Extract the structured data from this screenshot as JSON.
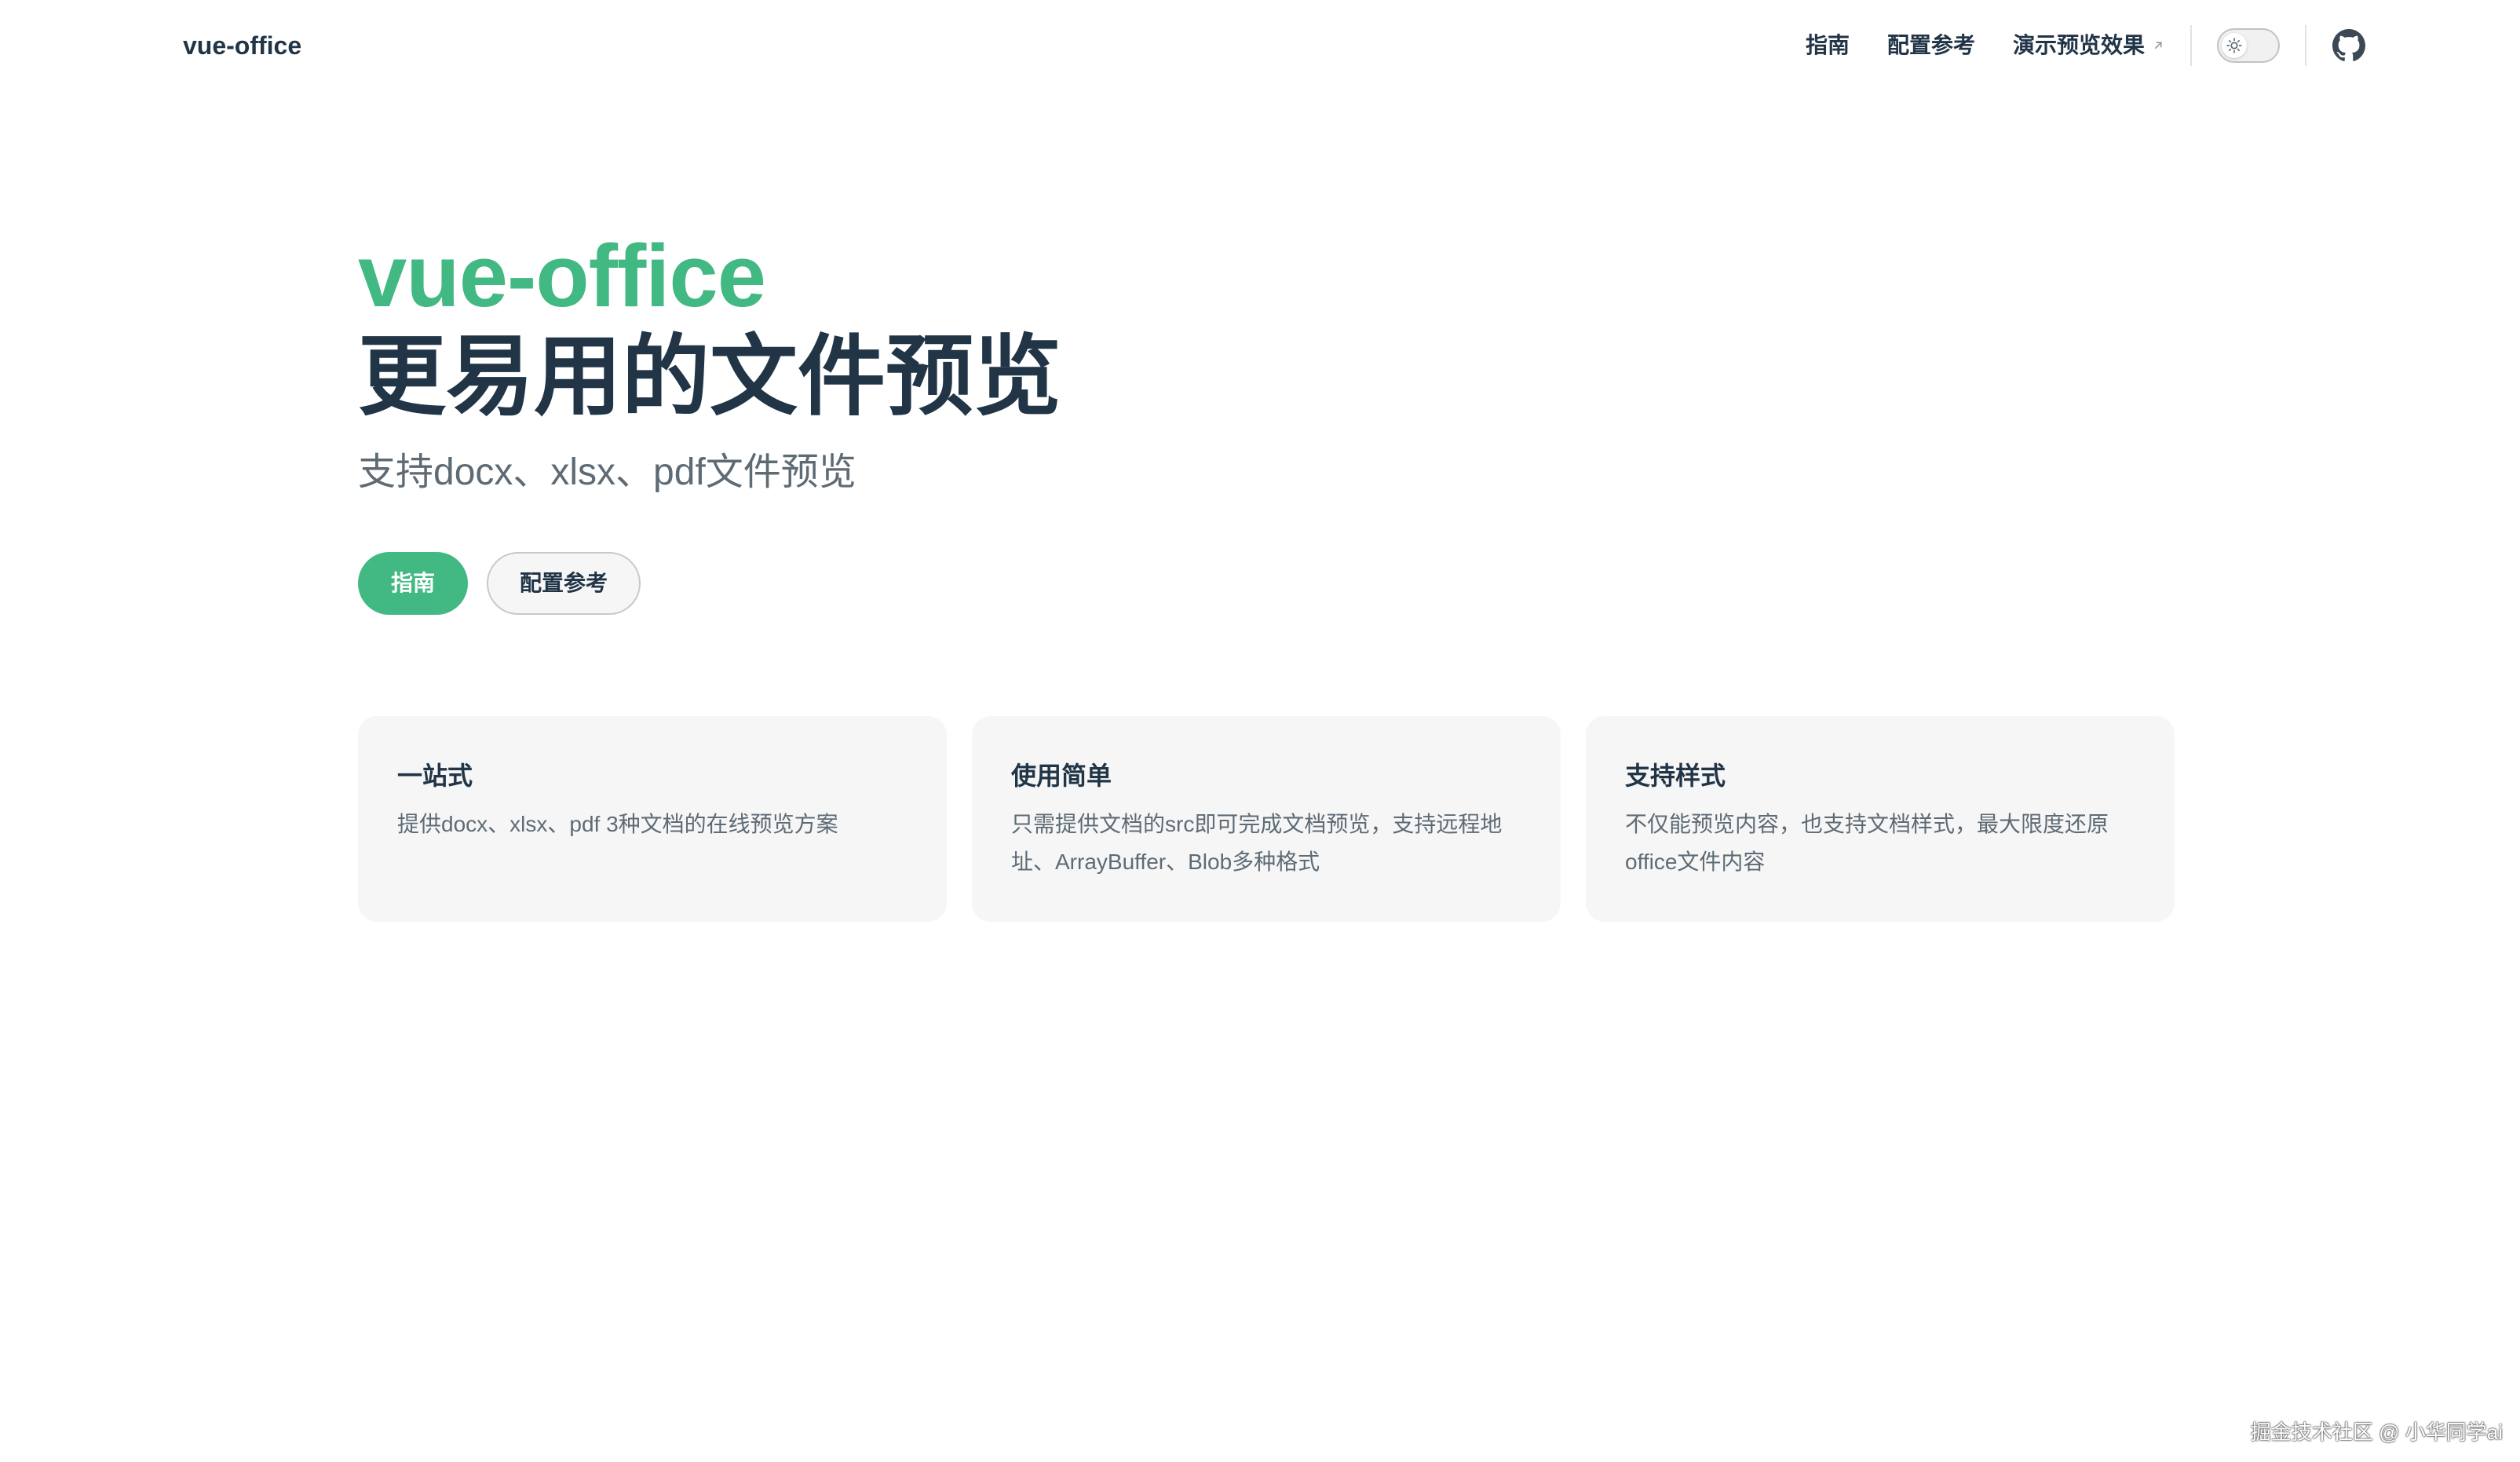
{
  "nav": {
    "brand": "vue-office",
    "links": [
      {
        "label": "指南"
      },
      {
        "label": "配置参考"
      },
      {
        "label": "演示预览效果"
      }
    ],
    "theme_toggle_icon": "sun-icon",
    "github_icon": "github-icon"
  },
  "hero": {
    "name": "vue-office",
    "text": "更易用的文件预览",
    "tagline": "支持docx、xlsx、pdf文件预览",
    "actions": [
      {
        "label": "指南"
      },
      {
        "label": "配置参考"
      }
    ]
  },
  "features": [
    {
      "title": "一站式",
      "details": "提供docx、xlsx、pdf 3种文档的在线预览方案"
    },
    {
      "title": "使用简单",
      "details": "只需提供文档的src即可完成文档预览，支持远程地址、ArrayBuffer、Blob多种格式"
    },
    {
      "title": "支持样式",
      "details": "不仅能预览内容，也支持文档样式，最大限度还原office文件内容"
    }
  ],
  "watermark": "掘金技术社区 @ 小华同学ai",
  "colors": {
    "brand": "#42b883",
    "text": "#213547",
    "muted": "#5e6b74",
    "card_bg": "#f6f6f7"
  }
}
